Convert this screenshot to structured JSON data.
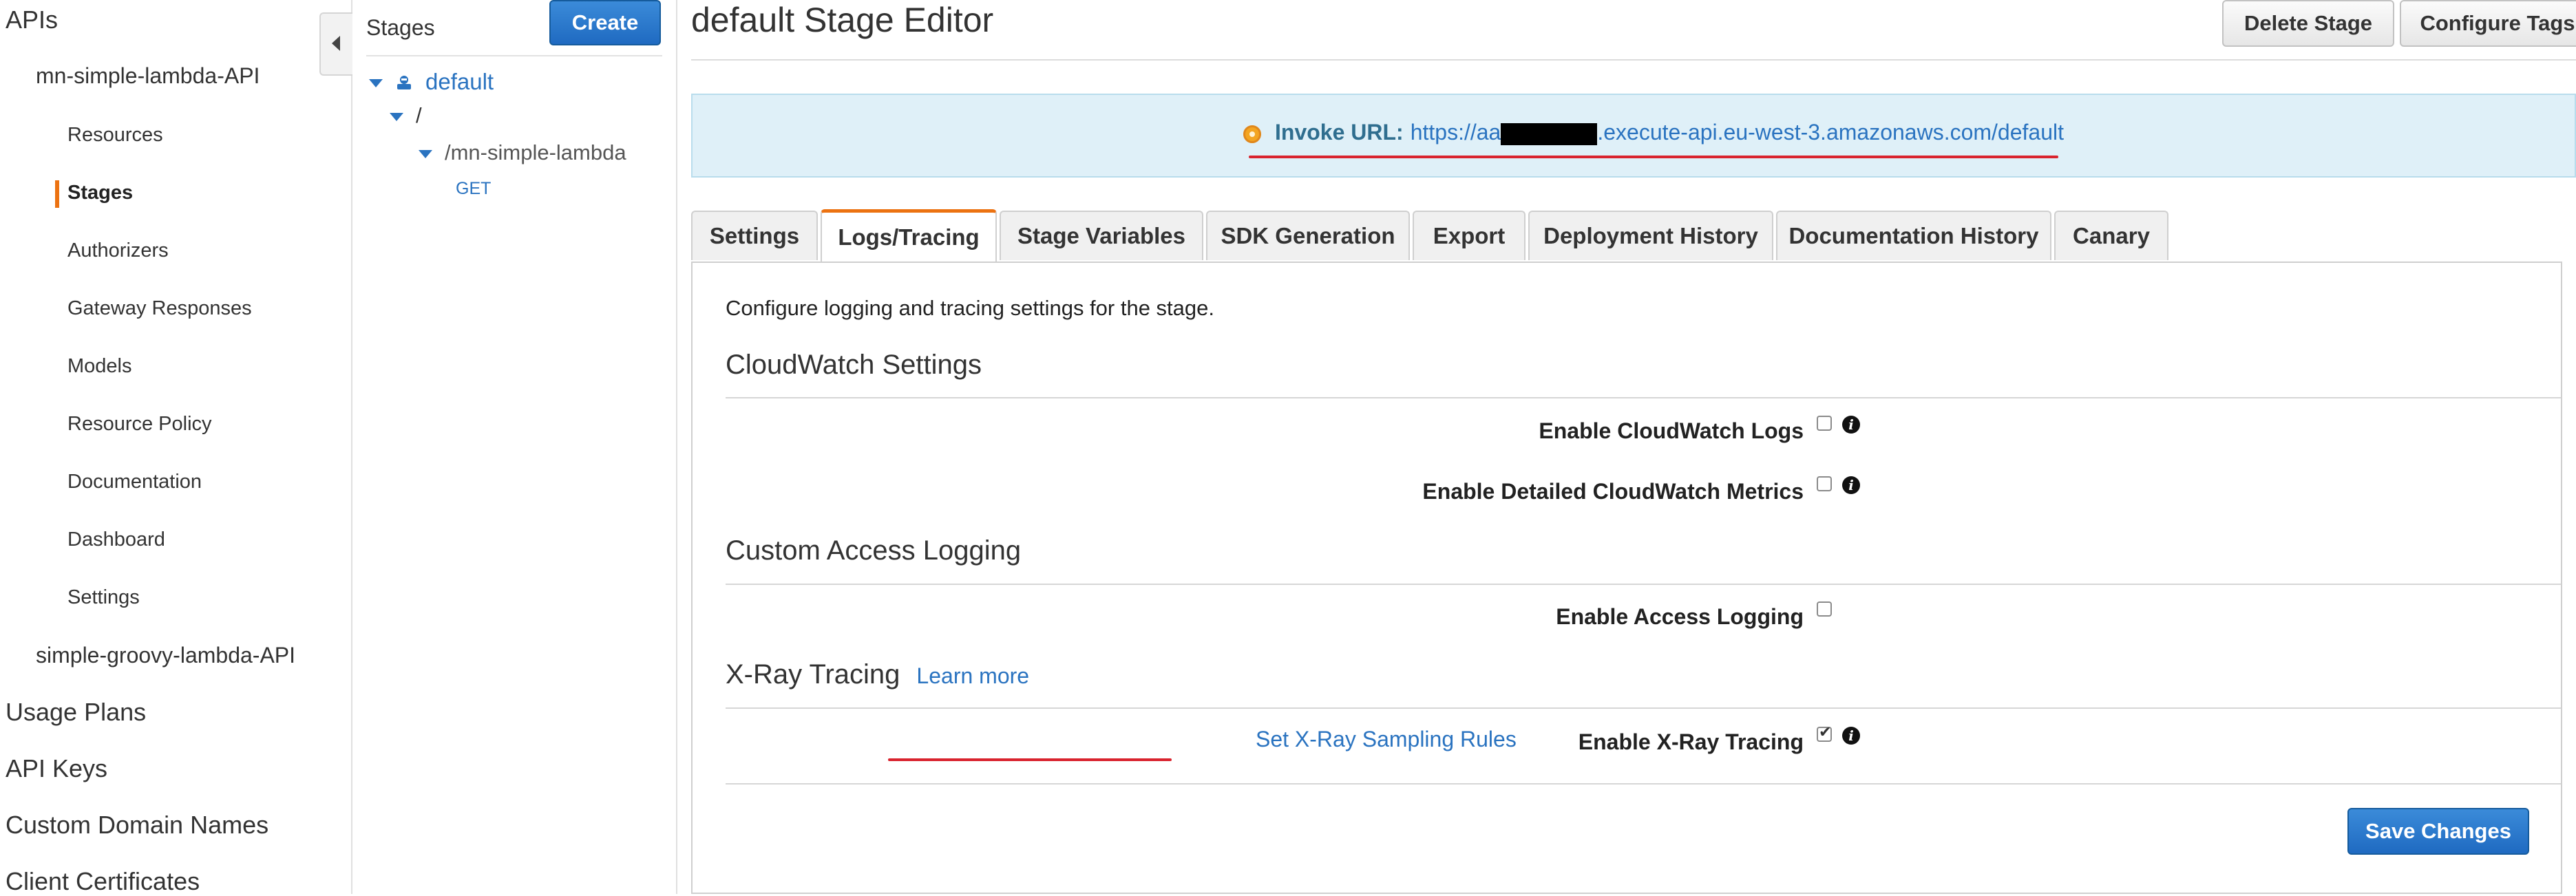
{
  "nav": {
    "apis": "APIs",
    "api_name": "mn-simple-lambda-API",
    "items": [
      {
        "label": "Resources"
      },
      {
        "label": "Stages"
      },
      {
        "label": "Authorizers"
      },
      {
        "label": "Gateway Responses"
      },
      {
        "label": "Models"
      },
      {
        "label": "Resource Policy"
      },
      {
        "label": "Documentation"
      },
      {
        "label": "Dashboard"
      },
      {
        "label": "Settings"
      }
    ],
    "active_item": "Stages",
    "other_api": "simple-groovy-lambda-API",
    "usage_plans": "Usage Plans",
    "api_keys": "API Keys",
    "custom_domains": "Custom Domain Names",
    "client_certs": "Client Certificates"
  },
  "stages": {
    "title": "Stages",
    "create_label": "Create",
    "tree": {
      "stage": "default",
      "root": "/",
      "resource": "/mn-simple-lambda",
      "method": "GET"
    }
  },
  "editor": {
    "title": "default Stage Editor",
    "delete_label": "Delete Stage",
    "tags_label": "Configure Tags",
    "invoke_label": "Invoke URL:",
    "invoke_url_prefix": "https://aa",
    "invoke_url_suffix": ".execute-api.eu-west-3.amazonaws.com/default"
  },
  "tabs": [
    {
      "label": "Settings"
    },
    {
      "label": "Logs/Tracing"
    },
    {
      "label": "Stage Variables"
    },
    {
      "label": "SDK Generation"
    },
    {
      "label": "Export"
    },
    {
      "label": "Deployment History"
    },
    {
      "label": "Documentation History"
    },
    {
      "label": "Canary"
    }
  ],
  "active_tab": "Logs/Tracing",
  "panel": {
    "intro": "Configure logging and tracing settings for the stage.",
    "cloudwatch_title": "CloudWatch Settings",
    "cw_logs_label": "Enable CloudWatch Logs",
    "cw_metrics_label": "Enable Detailed CloudWatch Metrics",
    "access_title": "Custom Access Logging",
    "access_label": "Enable Access Logging",
    "xray_title": "X-Ray Tracing",
    "learn_more": "Learn more",
    "xray_label": "Enable X-Ray Tracing",
    "xray_rules_link": "Set X-Ray Sampling Rules",
    "save_label": "Save Changes"
  },
  "colors": {
    "accent_orange": "#ec7211",
    "link_blue": "#2a73c0",
    "primary_button": "#1f6ac1",
    "invoke_bg": "#dff0f8",
    "annotation_red": "#d9232e"
  }
}
